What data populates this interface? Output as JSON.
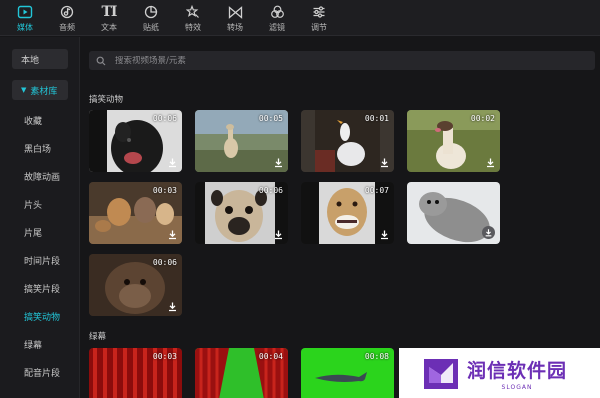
{
  "toolbar": {
    "items": [
      {
        "label": "媒体",
        "icon": "media-icon",
        "active": true
      },
      {
        "label": "音频",
        "icon": "audio-icon"
      },
      {
        "label": "文本",
        "icon": "text-icon"
      },
      {
        "label": "贴纸",
        "icon": "sticker-icon"
      },
      {
        "label": "特效",
        "icon": "effects-icon"
      },
      {
        "label": "转场",
        "icon": "transition-icon"
      },
      {
        "label": "滤镜",
        "icon": "filter-icon"
      },
      {
        "label": "调节",
        "icon": "adjust-icon"
      }
    ],
    "accent_color": "#22c6d8"
  },
  "sidebar": {
    "local_label": "本地",
    "library_label": "素材库",
    "items": [
      "收藏",
      "黑白场",
      "故障动画",
      "片头",
      "片尾",
      "时间片段",
      "搞笑片段",
      "搞笑动物",
      "绿幕",
      "配音片段"
    ],
    "active_item": "搞笑动物"
  },
  "search": {
    "placeholder": "搜索视频场景/元素"
  },
  "sections": [
    {
      "title": "搞笑动物",
      "clips": [
        {
          "duration": "00:06",
          "subject": "black-dog"
        },
        {
          "duration": "00:05",
          "subject": "llama"
        },
        {
          "duration": "00:01",
          "subject": "seagull"
        },
        {
          "duration": "00:02",
          "subject": "llama-tongue"
        },
        {
          "duration": "00:03",
          "subject": "cats"
        },
        {
          "duration": "00:06",
          "subject": "pug"
        },
        {
          "duration": "00:07",
          "subject": "dog-teeth"
        },
        {
          "duration": "",
          "subject": "seal"
        },
        {
          "duration": "00:06",
          "subject": "monkey"
        }
      ]
    },
    {
      "title": "绿幕",
      "clips": [
        {
          "duration": "00:03",
          "subject": "red-curtain"
        },
        {
          "duration": "00:04",
          "subject": "curtain-green"
        },
        {
          "duration": "00:08",
          "subject": "green-shark"
        }
      ]
    }
  ],
  "watermark": {
    "name": "润信软件园",
    "slogan": "SLOGAN",
    "color": "#6c2fb5"
  }
}
